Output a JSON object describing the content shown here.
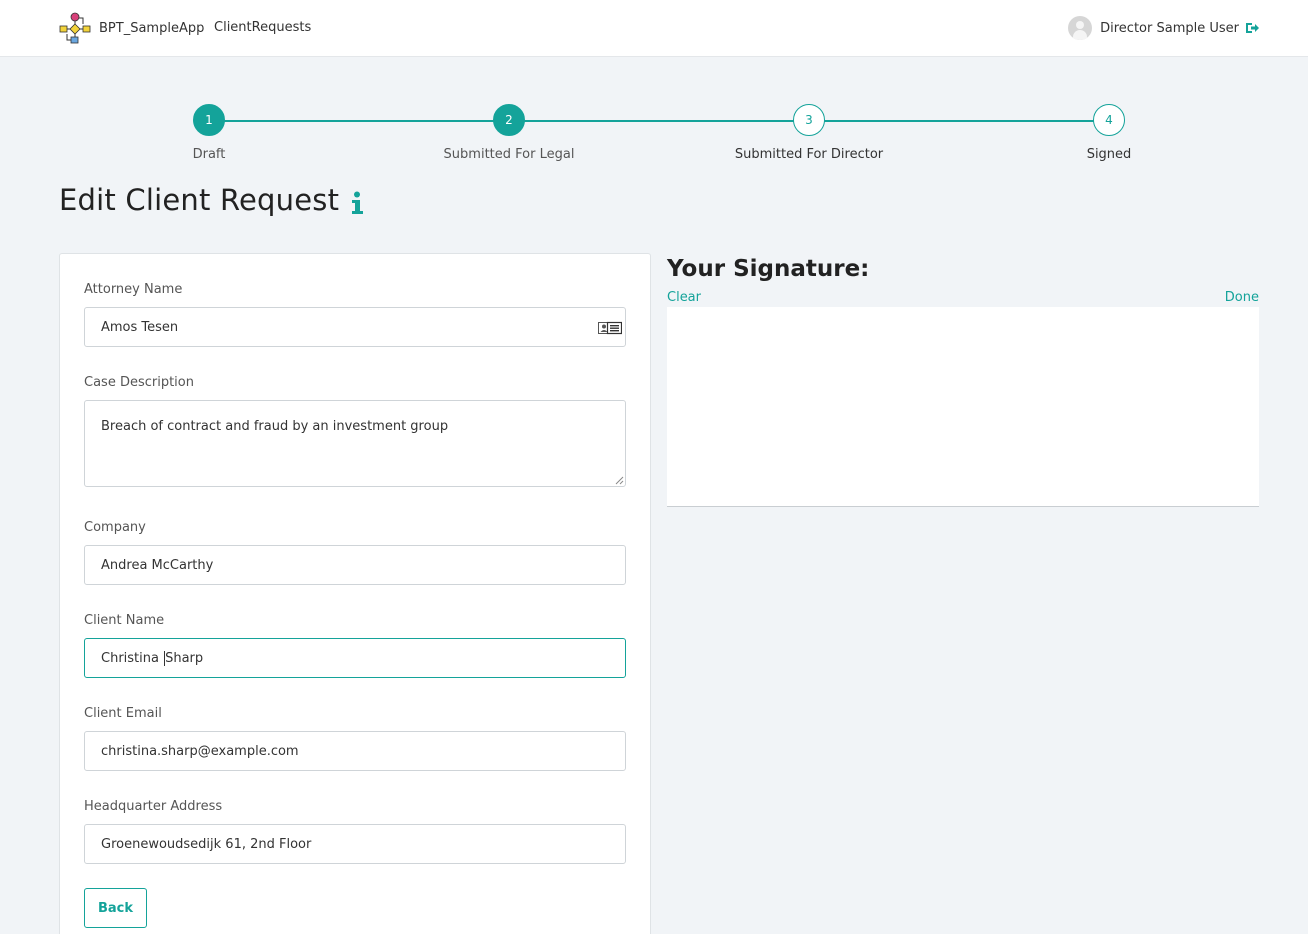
{
  "navbar": {
    "app_name": "BPT_SampleApp",
    "nav_link": "ClientRequests",
    "user_name": "Director Sample User"
  },
  "stepper": {
    "steps": [
      {
        "number": "1",
        "label": "Draft",
        "state": "completed"
      },
      {
        "number": "2",
        "label": "Submitted For Legal",
        "state": "current"
      },
      {
        "number": "3",
        "label": "Submitted For Director",
        "state": "pending"
      },
      {
        "number": "4",
        "label": "Signed",
        "state": "pending"
      }
    ]
  },
  "page": {
    "title": "Edit Client Request"
  },
  "form": {
    "attorney_name": {
      "label": "Attorney Name",
      "value": "Amos Tesen"
    },
    "case_description": {
      "label": "Case Description",
      "value": "Breach of contract and fraud by an investment group"
    },
    "company": {
      "label": "Company",
      "value": "Andrea McCarthy"
    },
    "client_name": {
      "label": "Client Name",
      "value_before_caret": "Christina ",
      "value_after_caret": "Sharp"
    },
    "client_email": {
      "label": "Client Email",
      "value": "christina.sharp@example.com"
    },
    "headquarter_address": {
      "label": "Headquarter Address",
      "value": "Groenewoudsedijk 61, 2nd Floor"
    },
    "back_label": "Back"
  },
  "signature": {
    "title": "Your Signature:",
    "clear_label": "Clear",
    "done_label": "Done"
  },
  "colors": {
    "accent": "#14a39a",
    "background": "#f1f4f7"
  },
  "icons": [
    "bpmn-logo-icon",
    "user-avatar-icon",
    "logout-icon",
    "info-icon",
    "contact-card-icon",
    "resize-grip-icon"
  ]
}
